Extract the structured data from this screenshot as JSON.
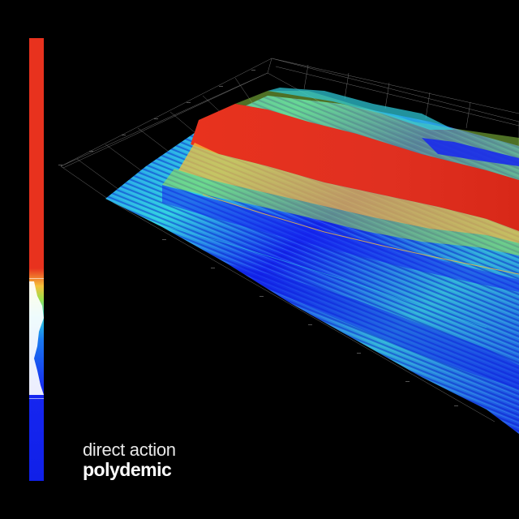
{
  "cover": {
    "artist": "direct action",
    "title": "polydemic"
  },
  "colors": {
    "background": "#000000",
    "high": "#e8321e",
    "mid_high": "#f6c03a",
    "mid": "#9be04a",
    "mid_low": "#2fd0e0",
    "low": "#1626f0",
    "text_light": "#e8e8e8"
  }
}
